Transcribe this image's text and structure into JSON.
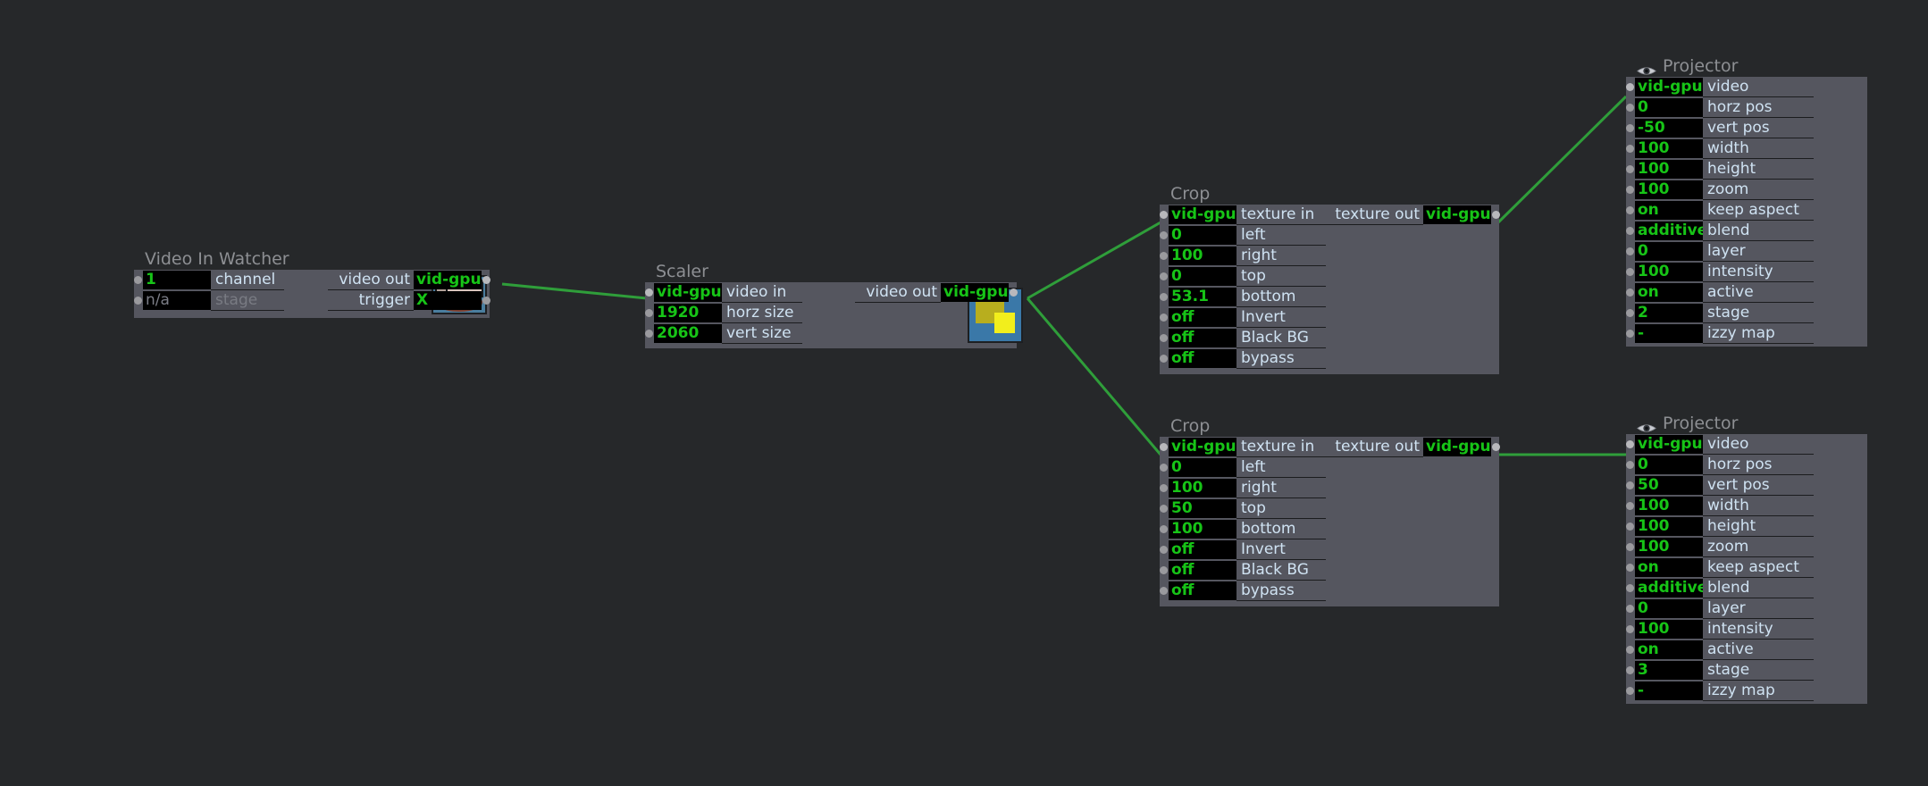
{
  "canvas": {
    "background": "#26282a",
    "wire_color": "#2f9e3a",
    "value_color": "#17c417",
    "panel_color": "#55565f",
    "label_color": "#cfe2f2",
    "title_color": "#8d8f93"
  },
  "nodes": [
    {
      "id": "video-in-watcher",
      "title": "Video In Watcher",
      "icon": "camcorder-eye-icon",
      "inputs": [
        {
          "value": "1",
          "label": "channel",
          "dim": false
        },
        {
          "value": "n/a",
          "label": "stage",
          "dim": true
        }
      ],
      "outputs": [
        {
          "label": "video out",
          "value": "vid-gpu"
        },
        {
          "label": "trigger",
          "value": "X"
        }
      ]
    },
    {
      "id": "scaler",
      "title": "Scaler",
      "icon": "scaler-icon",
      "inputs": [
        {
          "value": "vid-gpu",
          "label": "video in",
          "dim": false
        },
        {
          "value": "1920",
          "label": "horz size",
          "dim": false
        },
        {
          "value": "2060",
          "label": "vert size",
          "dim": false
        }
      ],
      "outputs": [
        {
          "label": "video out",
          "value": "vid-gpu"
        }
      ]
    },
    {
      "id": "crop-top",
      "title": "Crop",
      "icon": null,
      "inputs": [
        {
          "value": "vid-gpu",
          "label": "texture in",
          "dim": false
        },
        {
          "value": "0",
          "label": "left",
          "dim": false
        },
        {
          "value": "100",
          "label": "right",
          "dim": false
        },
        {
          "value": "0",
          "label": "top",
          "dim": false
        },
        {
          "value": "53.1",
          "label": "bottom",
          "dim": false
        },
        {
          "value": "off",
          "label": "Invert",
          "dim": false
        },
        {
          "value": "off",
          "label": "Black BG",
          "dim": false
        },
        {
          "value": "off",
          "label": "bypass",
          "dim": false
        }
      ],
      "outputs": [
        {
          "label": "texture out",
          "value": "vid-gpu"
        }
      ]
    },
    {
      "id": "crop-bottom",
      "title": "Crop",
      "icon": null,
      "inputs": [
        {
          "value": "vid-gpu",
          "label": "texture in",
          "dim": false
        },
        {
          "value": "0",
          "label": "left",
          "dim": false
        },
        {
          "value": "100",
          "label": "right",
          "dim": false
        },
        {
          "value": "50",
          "label": "top",
          "dim": false
        },
        {
          "value": "100",
          "label": "bottom",
          "dim": false
        },
        {
          "value": "off",
          "label": "Invert",
          "dim": false
        },
        {
          "value": "off",
          "label": "Black BG",
          "dim": false
        },
        {
          "value": "off",
          "label": "bypass",
          "dim": false
        }
      ],
      "outputs": [
        {
          "label": "texture out",
          "value": "vid-gpu"
        }
      ]
    },
    {
      "id": "projector-top",
      "title": "Projector",
      "icon": "projector-icon",
      "title_icon": "eye-icon",
      "inputs": [
        {
          "value": "vid-gpu",
          "label": "video",
          "dim": false
        },
        {
          "value": "0",
          "label": "horz pos",
          "dim": false
        },
        {
          "value": "-50",
          "label": "vert pos",
          "dim": false
        },
        {
          "value": "100",
          "label": "width",
          "dim": false
        },
        {
          "value": "100",
          "label": "height",
          "dim": false
        },
        {
          "value": "100",
          "label": "zoom",
          "dim": false
        },
        {
          "value": "on",
          "label": "keep aspect",
          "dim": false
        },
        {
          "value": "additive",
          "label": "blend",
          "dim": false
        },
        {
          "value": "0",
          "label": "layer",
          "dim": false
        },
        {
          "value": "100",
          "label": "intensity",
          "dim": false
        },
        {
          "value": "on",
          "label": "active",
          "dim": false
        },
        {
          "value": "2",
          "label": "stage",
          "dim": false
        },
        {
          "value": "-",
          "label": "izzy map",
          "dim": false
        }
      ],
      "outputs": []
    },
    {
      "id": "projector-bottom",
      "title": "Projector",
      "icon": "projector-icon",
      "title_icon": "eye-icon",
      "inputs": [
        {
          "value": "vid-gpu",
          "label": "video",
          "dim": false
        },
        {
          "value": "0",
          "label": "horz pos",
          "dim": false
        },
        {
          "value": "50",
          "label": "vert pos",
          "dim": false
        },
        {
          "value": "100",
          "label": "width",
          "dim": false
        },
        {
          "value": "100",
          "label": "height",
          "dim": false
        },
        {
          "value": "100",
          "label": "zoom",
          "dim": false
        },
        {
          "value": "on",
          "label": "keep aspect",
          "dim": false
        },
        {
          "value": "additive",
          "label": "blend",
          "dim": false
        },
        {
          "value": "0",
          "label": "layer",
          "dim": false
        },
        {
          "value": "100",
          "label": "intensity",
          "dim": false
        },
        {
          "value": "on",
          "label": "active",
          "dim": false
        },
        {
          "value": "3",
          "label": "stage",
          "dim": false
        },
        {
          "value": "-",
          "label": "izzy map",
          "dim": false
        }
      ],
      "outputs": []
    }
  ],
  "connections": [
    {
      "from": "video-in-watcher.video out",
      "to": "scaler.video in"
    },
    {
      "from": "scaler.video out",
      "to": "crop-top.texture in"
    },
    {
      "from": "scaler.video out",
      "to": "crop-bottom.texture in"
    },
    {
      "from": "crop-top.texture out",
      "to": "projector-top.video"
    },
    {
      "from": "crop-bottom.texture out",
      "to": "projector-bottom.video"
    }
  ]
}
